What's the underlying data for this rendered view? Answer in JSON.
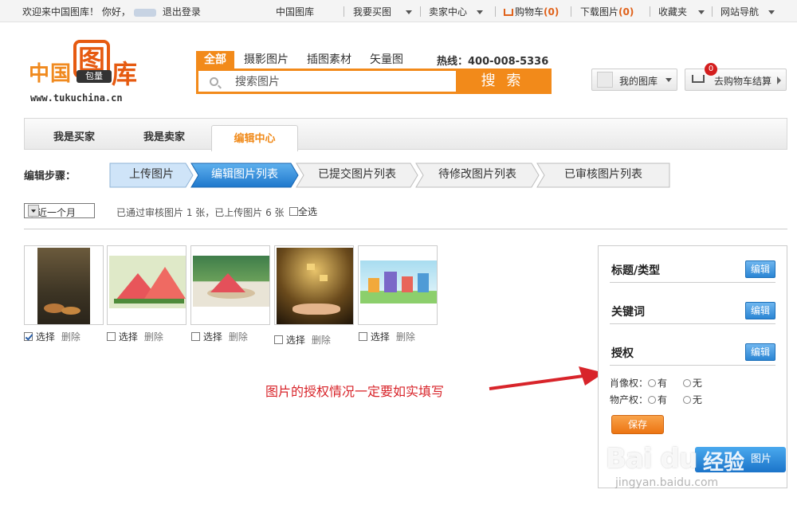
{
  "topbar": {
    "welcome": "欢迎来中国图库！ 你好，",
    "logout": "退出登录",
    "links": [
      {
        "label": "中国图库"
      },
      {
        "label": "我要买图"
      },
      {
        "label": "卖家中心"
      },
      {
        "label": "购物车",
        "count": "(0)"
      },
      {
        "label": "下载图片",
        "count": "(0)"
      },
      {
        "label": "收藏夹"
      },
      {
        "label": "网站导航"
      }
    ]
  },
  "logo": {
    "zhongguo": "中国",
    "tu": "图",
    "baoliang": "包量",
    "ku": "库",
    "url": "www.tukuchina.cn"
  },
  "search": {
    "tabs": [
      "全部",
      "摄影图片",
      "插图素材",
      "矢量图"
    ],
    "hotline": "热线：400-008-5336",
    "placeholder": "搜索图片",
    "button": "搜 索"
  },
  "header_right": {
    "my_library": "我的图库",
    "cart_badge": "0",
    "cart_checkout": "去购物车结算"
  },
  "main_tabs": [
    "我是买家",
    "我是卖家",
    "编辑中心"
  ],
  "steps": {
    "label": "编辑步骤：",
    "items": [
      "上传图片",
      "编辑图片列表",
      "已提交图片列表",
      "待修改图片列表",
      "已审核图片列表"
    ]
  },
  "filter": {
    "period": "最近一个月",
    "status": "已通过审核图片 1 张，已上传图片 6 张",
    "select_all": "全选"
  },
  "thumbs": {
    "select_label": "选择",
    "delete_label": "删除",
    "items": [
      {
        "checked": true
      },
      {
        "checked": false
      },
      {
        "checked": false
      },
      {
        "checked": false
      },
      {
        "checked": false
      }
    ]
  },
  "panel": {
    "rows": [
      {
        "title": "标题/类型",
        "button": "编辑"
      },
      {
        "title": "关键词",
        "button": "编辑"
      },
      {
        "title": "授权",
        "button": "编辑"
      }
    ],
    "portrait_label": "肖像权：",
    "property_label": "物产权：",
    "yes": "有",
    "no": "无",
    "save": "保存",
    "big_button": "图片"
  },
  "annotation": "图片的授权情况一定要如实填写",
  "watermark": {
    "brand": "Bai du",
    "jingyan": "经验",
    "url": "jingyan.baidu.com"
  },
  "colors": {
    "accent": "#f28a1a",
    "brand_red": "#e65a10",
    "step_active": "#2a85d4",
    "annotation": "#d8242a"
  }
}
